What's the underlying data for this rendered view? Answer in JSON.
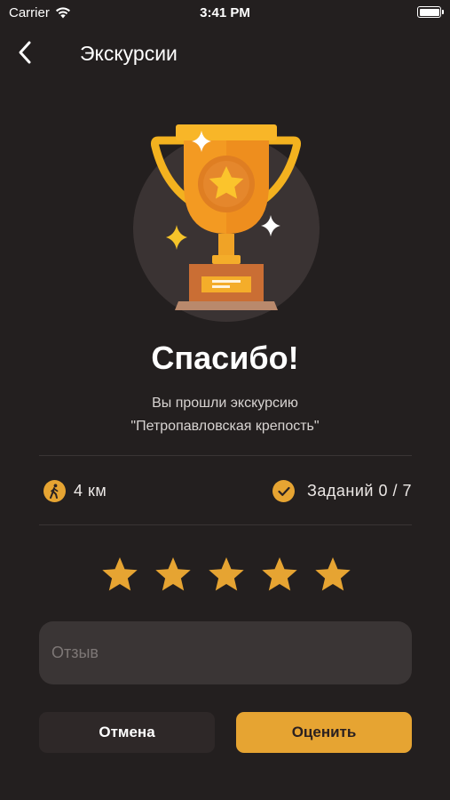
{
  "status_bar": {
    "carrier": "Carrier",
    "time": "3:41 PM"
  },
  "nav": {
    "title": "Экскурсии"
  },
  "result": {
    "title": "Спасибо!",
    "line1": "Вы прошли экскурсию",
    "line2": "\"Петропавловская крепость\""
  },
  "stats": {
    "distance": "4 км",
    "tasks": "Заданий 0 / 7"
  },
  "rating": {
    "max": 5,
    "selected": 5,
    "star_color": "#e6a432"
  },
  "review": {
    "placeholder": "Отзыв",
    "value": ""
  },
  "buttons": {
    "cancel": "Отмена",
    "rate": "Оценить"
  },
  "colors": {
    "background": "#231f1f",
    "accent": "#e6a432",
    "input_bg": "#3a3535"
  }
}
